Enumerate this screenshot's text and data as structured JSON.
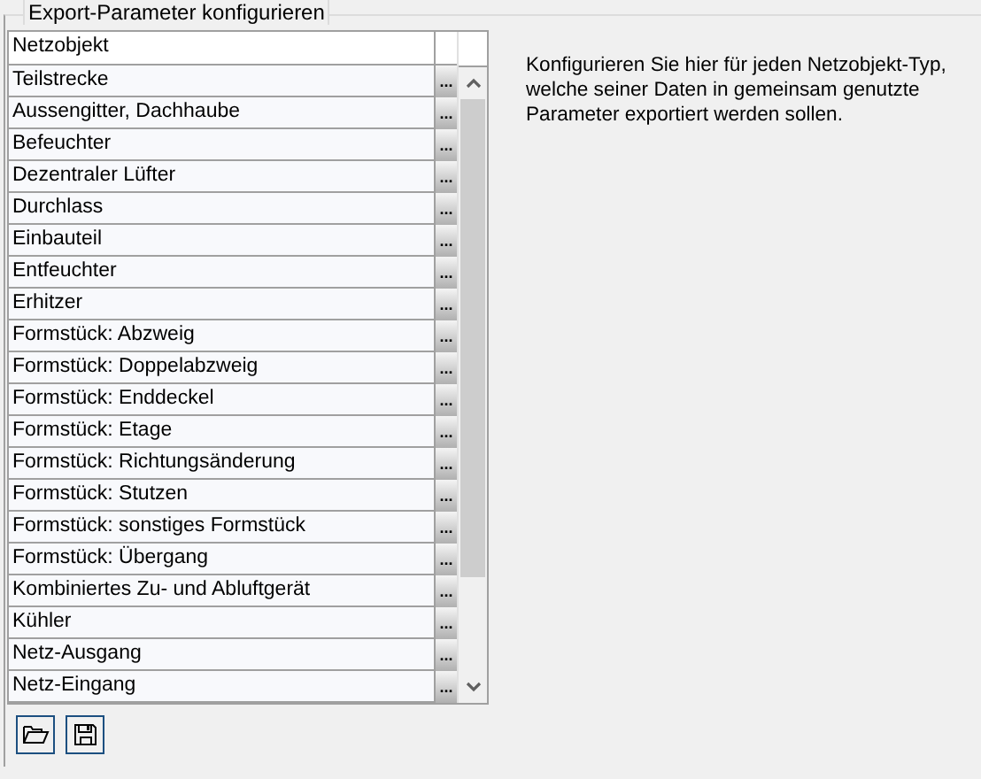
{
  "group": {
    "title": "Export-Parameter konfigurieren"
  },
  "table": {
    "columns": [
      "Netzobjekt"
    ],
    "rows": [
      {
        "name": "Teilstrecke",
        "action": "..."
      },
      {
        "name": "Aussengitter, Dachhaube",
        "action": "..."
      },
      {
        "name": "Befeuchter",
        "action": "..."
      },
      {
        "name": "Dezentraler Lüfter",
        "action": "..."
      },
      {
        "name": "Durchlass",
        "action": "..."
      },
      {
        "name": "Einbauteil",
        "action": "..."
      },
      {
        "name": "Entfeuchter",
        "action": "..."
      },
      {
        "name": "Erhitzer",
        "action": "..."
      },
      {
        "name": "Formstück: Abzweig",
        "action": "..."
      },
      {
        "name": "Formstück: Doppelabzweig",
        "action": "..."
      },
      {
        "name": "Formstück: Enddeckel",
        "action": "..."
      },
      {
        "name": "Formstück: Etage",
        "action": "..."
      },
      {
        "name": "Formstück: Richtungsänderung",
        "action": "..."
      },
      {
        "name": "Formstück: Stutzen",
        "action": "..."
      },
      {
        "name": "Formstück: sonstiges Formstück",
        "action": "..."
      },
      {
        "name": "Formstück: Übergang",
        "action": "..."
      },
      {
        "name": "Kombiniertes Zu- und Abluftgerät",
        "action": "..."
      },
      {
        "name": "Kühler",
        "action": "..."
      },
      {
        "name": "Netz-Ausgang",
        "action": "..."
      },
      {
        "name": "Netz-Eingang",
        "action": "..."
      }
    ]
  },
  "description": "Konfigurieren Sie hier für jeden Netzobjekt-Typ, welche seiner Daten in gemeinsam genutzte Parameter exportiert werden sollen.",
  "toolbar": [
    {
      "kind": "open"
    },
    {
      "kind": "save"
    }
  ]
}
